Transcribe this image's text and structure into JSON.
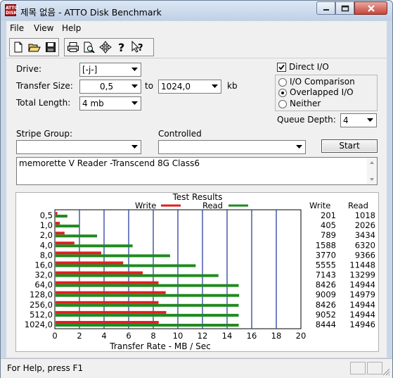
{
  "window": {
    "title": "제목 없음 - ATTO Disk Benchmark",
    "app_icon_text": "ATTO\nDISK"
  },
  "menu": [
    "File",
    "View",
    "Help"
  ],
  "toolbar": {
    "icons": [
      "new-file-icon",
      "open-folder-icon",
      "save-icon",
      "print-icon",
      "print-preview-icon",
      "move-icon",
      "help-icon",
      "context-help-icon"
    ]
  },
  "settings": {
    "drive_label": "Drive:",
    "drive_value": "[-j-]",
    "transfer_size_label": "Transfer Size:",
    "transfer_from": "0,5",
    "to_label": "to",
    "transfer_to": "1024,0",
    "unit_label": "kb",
    "total_length_label": "Total Length:",
    "total_length_value": "4 mb",
    "direct_io_label": "Direct I/O",
    "direct_io_checked": true,
    "io_options": [
      "I/O Comparison",
      "Overlapped I/O",
      "Neither"
    ],
    "io_selected": "Overlapped I/O",
    "queue_depth_label": "Queue Depth:",
    "queue_depth_value": "4",
    "stripe_group_label": "Stripe Group:",
    "stripe_group_value": "",
    "controlled_label": "Controlled",
    "controlled_value": "",
    "start_label": "Start",
    "description": "memorette V Reader -Transcend 8G Class6"
  },
  "chart_data": {
    "type": "bar",
    "orientation": "horizontal",
    "title": "Test Results",
    "xlabel": "Transfer Rate - MB / Sec",
    "xlim": [
      0,
      20
    ],
    "xticks": [
      "0",
      "2",
      "4",
      "6",
      "8",
      "10",
      "12",
      "14",
      "16",
      "18",
      "20"
    ],
    "grid": true,
    "legend_position": "top",
    "categories": [
      "0,5",
      "1,0",
      "2,0",
      "4,0",
      "8,0",
      "16,0",
      "32,0",
      "64,0",
      "128,0",
      "256,0",
      "512,0",
      "1024,0"
    ],
    "series": [
      {
        "name": "Write",
        "color": "#e02020",
        "values": [
          0.201,
          0.405,
          0.789,
          1.588,
          3.77,
          5.555,
          7.143,
          8.426,
          9.009,
          8.426,
          9.052,
          8.444
        ]
      },
      {
        "name": "Read",
        "color": "#1f8a1f",
        "values": [
          1.018,
          2.026,
          3.434,
          6.32,
          9.366,
          11.448,
          13.299,
          14.944,
          14.979,
          14.944,
          14.944,
          14.946
        ]
      }
    ],
    "table_headers": [
      "Write",
      "Read"
    ],
    "table_write": [
      "201",
      "405",
      "789",
      "1588",
      "3770",
      "5555",
      "7143",
      "8426",
      "9009",
      "8426",
      "9052",
      "8444"
    ],
    "table_read": [
      "1018",
      "2026",
      "3434",
      "6320",
      "9366",
      "11448",
      "13299",
      "14944",
      "14979",
      "14944",
      "14944",
      "14946"
    ]
  },
  "status": {
    "text": "For Help, press F1"
  }
}
